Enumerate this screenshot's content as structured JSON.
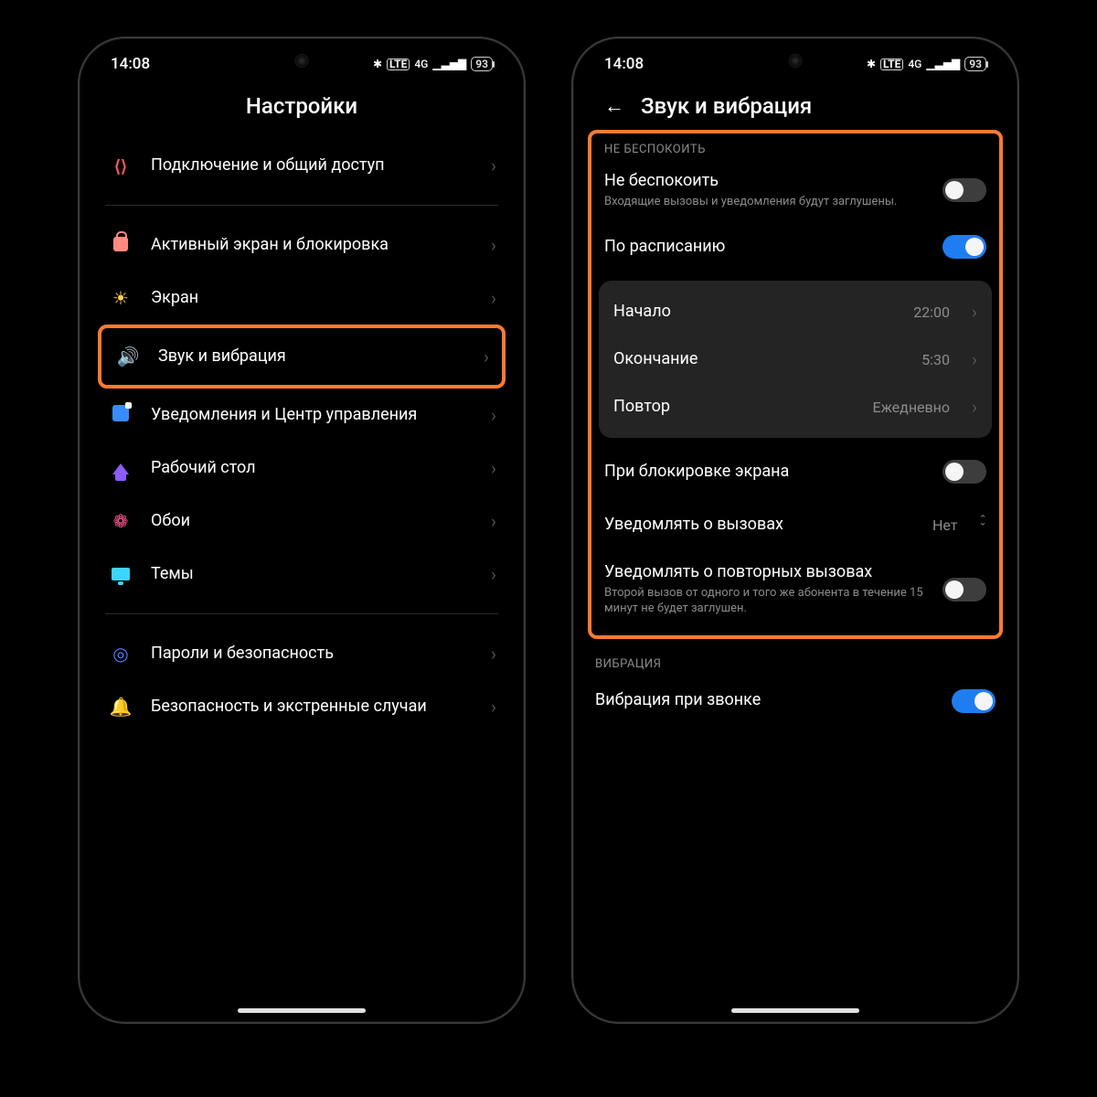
{
  "status": {
    "time": "14:08",
    "bt": "✱",
    "lte": "LTE",
    "net": "4G",
    "battery": "93"
  },
  "left": {
    "title": "Настройки",
    "rows": {
      "share": "Подключение и общий доступ",
      "lock": "Активный экран и блокировка",
      "screen": "Экран",
      "sound": "Звук и вибрация",
      "notif": "Уведомления и Центр управления",
      "desktop": "Рабочий стол",
      "wallpaper": "Обои",
      "themes": "Темы",
      "passwords": "Пароли и безопасность",
      "safety": "Безопасность и экстренные случаи"
    }
  },
  "right": {
    "title": "Звук и вибрация",
    "dnd_section": "НЕ БЕСПОКОИТЬ",
    "dnd_title": "Не беспокоить",
    "dnd_sub": "Входящие вызовы и уведомления будут заглушены.",
    "schedule_title": "По расписанию",
    "start_label": "Начало",
    "start_value": "22:00",
    "end_label": "Окончание",
    "end_value": "5:30",
    "repeat_label": "Повтор",
    "repeat_value": "Ежедневно",
    "when_locked": "При блокировке экрана",
    "notify_calls": "Уведомлять о вызовах",
    "notify_calls_value": "Нет",
    "repeated_calls_title": "Уведомлять о повторных вызовах",
    "repeated_calls_sub": "Второй вызов от одного и того же абонента в течение 15 минут не будет заглушен.",
    "vibration_section": "ВИБРАЦИЯ",
    "vibrate_on_ring": "Вибрация при звонке"
  }
}
